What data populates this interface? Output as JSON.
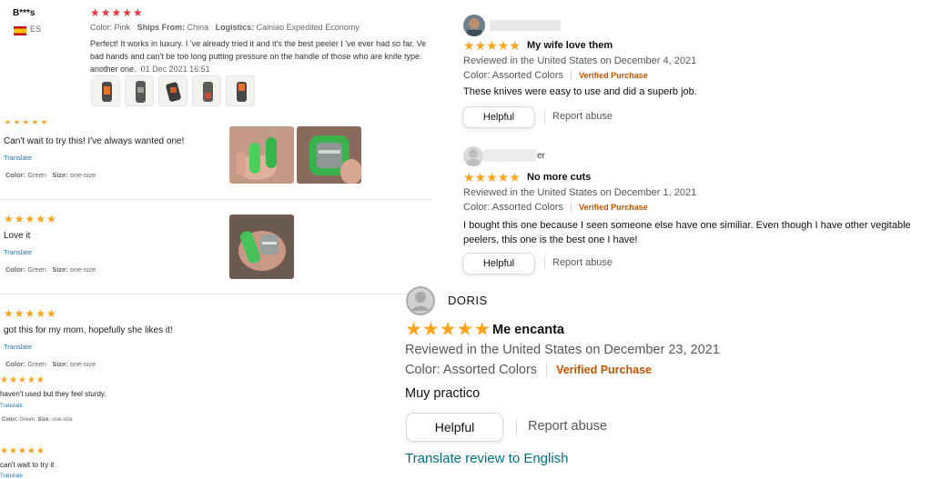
{
  "ali_top": {
    "reviewer": "B***s",
    "country_code": "ES",
    "stars": "★★★★★",
    "color_label": "Color:",
    "color_value": "Pink",
    "ships_label": "Ships From:",
    "ships_value": "China",
    "logistics_label": "Logistics:",
    "logistics_value": "Cainiao Expedited Economy",
    "text_line1": "Perfect! It works in luxury. I 've already tried it and it's the best peeler I 've ever had so far. Ve",
    "text_line2": "bad hands and can't be too long putting pressure on the handle of those who are knife type.",
    "text_line3": "another one.",
    "date": "01 Dec 2021 16:51"
  },
  "ali_list": [
    {
      "stars": "★★★★★",
      "text": "Can't wait to try this! I've always wanted one!",
      "translate": "Translate",
      "color_label": "Color:",
      "color_value": "Green",
      "size_label": "Size:",
      "size_value": "one-size"
    },
    {
      "stars": "★★★★★",
      "text": "Love it",
      "translate": "Translate",
      "color_label": "Color:",
      "color_value": "Green",
      "size_label": "Size:",
      "size_value": "one-size"
    },
    {
      "stars": "★★★★★",
      "text": "got this for my mom, hopefully she likes it!",
      "translate": "Translate",
      "color_label": "Color:",
      "color_value": "Green",
      "size_label": "Size:",
      "size_value": "one-size"
    },
    {
      "stars": "★★★★★",
      "text": "haven't used but they feel sturdy.",
      "translate": "Translate",
      "color_label": "Color:",
      "color_value": "Green",
      "size_label": "Size:",
      "size_value": "one-size"
    },
    {
      "stars": "★★★★★",
      "text": "can't wait to try it",
      "translate": "Translate"
    }
  ],
  "amz_reviews": [
    {
      "stars": "★★★★★",
      "title": "My wife love them",
      "reviewed": "Reviewed in the United States on December 4, 2021",
      "color": "Color: Assorted Colors",
      "verified": "Verified Purchase",
      "body1": "These knives were easy to use and did a superb job.",
      "body2": "",
      "helpful": "Helpful",
      "report": "Report abuse"
    },
    {
      "name_suffix": "er",
      "stars": "★★★★★",
      "title": "No more cuts",
      "reviewed": "Reviewed in the United States on December 1, 2021",
      "color": "Color: Assorted Colors",
      "verified": "Verified Purchase",
      "body1": "I bought this one because I seen someone else have one similiar. Even though I have other vegitable",
      "body2": "peelers, this one is the best one I have!",
      "helpful": "Helpful",
      "report": "Report abuse"
    }
  ],
  "amz_doris": {
    "name": "DORIS",
    "stars": "★★★★★",
    "title": "Me encanta",
    "reviewed": "Reviewed in the United States on December 23, 2021",
    "color": "Color: Assorted Colors",
    "verified": "Verified Purchase",
    "body": "Muy practico",
    "helpful": "Helpful",
    "report": "Report abuse",
    "translate": "Translate review to English"
  },
  "icons": {
    "star": "star-icon",
    "flag": "spain-flag-icon",
    "avatar": "user-avatar-icon"
  },
  "colors": {
    "ali_red": "#e4393c",
    "ali_orange": "#f8a31b",
    "amz_star": "#ffa41c",
    "verified": "#c45500",
    "link": "#1a6fb5",
    "amz_link": "#007185"
  }
}
